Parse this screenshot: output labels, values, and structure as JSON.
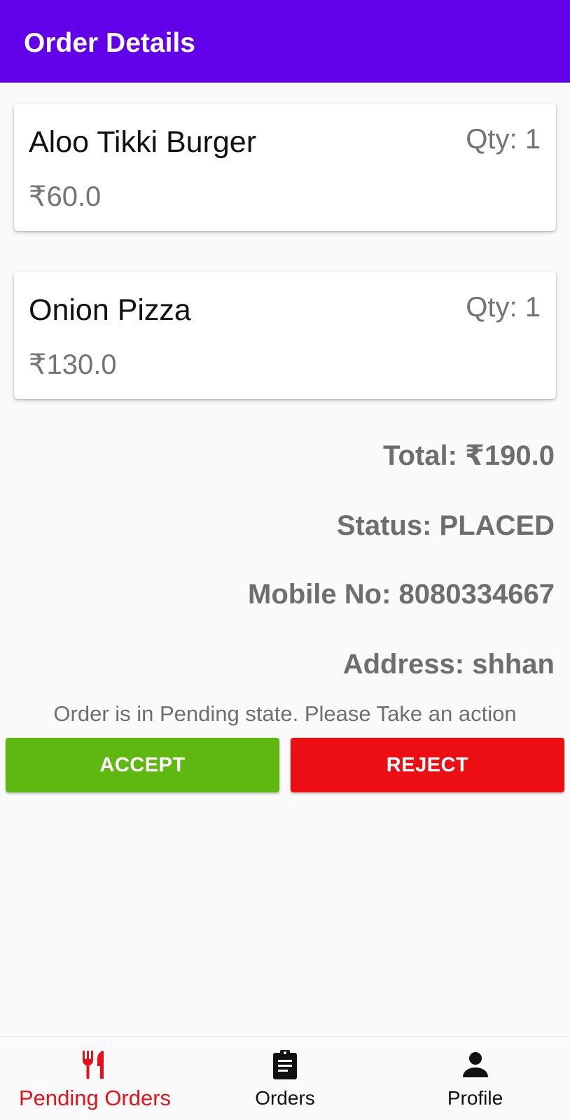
{
  "app_bar": {
    "title": "Order Details",
    "color": "#6200ea"
  },
  "items": [
    {
      "name": "Aloo Tikki Burger",
      "qty": "Qty: 1",
      "price": "₹60.0"
    },
    {
      "name": "Onion Pizza",
      "qty": "Qty: 1",
      "price": "₹130.0"
    }
  ],
  "summary": {
    "total": "Total: ₹190.0",
    "status": "Status: PLACED",
    "mobile": "Mobile No: 8080334667",
    "address": "Address: shhan"
  },
  "pending_note": "Order is in Pending state. Please Take an action",
  "actions": {
    "accept_label": "ACCEPT",
    "accept_color": "#5eb80f",
    "reject_label": "REJECT",
    "reject_color": "#ec0e12"
  },
  "bottom_nav": {
    "active_color": "#e8101a",
    "items": [
      {
        "label": "Pending Orders",
        "icon": "fork-knife-icon",
        "active": true
      },
      {
        "label": "Orders",
        "icon": "clipboard-icon",
        "active": false
      },
      {
        "label": "Profile",
        "icon": "person-icon",
        "active": false
      }
    ]
  }
}
